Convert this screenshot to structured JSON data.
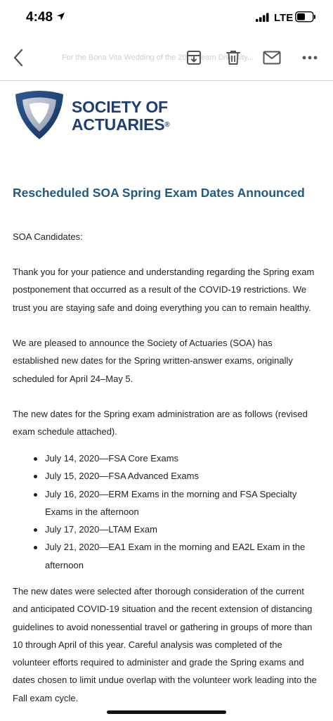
{
  "status_bar": {
    "time": "4:48",
    "network": "LTE"
  },
  "toolbar": {
    "subject_preview": "For the Bona Vita Wedding of the 2020 Team Diversity..."
  },
  "logo": {
    "line1": "SOCIETY OF",
    "line2": "ACTUARIES",
    "reg": "®"
  },
  "email": {
    "headline": "Rescheduled SOA Spring Exam Dates Announced",
    "greeting": "SOA Candidates:",
    "p1": "Thank you for your patience and understanding regarding the Spring exam postponement that occurred as a result of the COVID-19 restrictions. We trust you are staying safe and doing everything you can to remain healthy.",
    "p2": "We are pleased to announce the Society of Actuaries (SOA) has established new dates for the Spring written-answer exams, originally scheduled for April 24–May 5.",
    "p3": "The new dates for the Spring exam administration are as follows (revised exam schedule attached).",
    "dates": [
      "July 14, 2020—FSA Core Exams",
      "July 15, 2020—FSA Advanced Exams",
      "July 16, 2020—ERM Exams in the morning and FSA Specialty Exams in the afternoon",
      "July 17, 2020—LTAM Exam",
      "July 21, 2020—EA1 Exam in the morning and EA2L Exam in the afternoon"
    ],
    "p4": "The new dates were selected after thorough consideration of the current and anticipated COVID-19 situation and the recent extension of distancing guidelines to avoid nonessential travel or gathering in groups of more than 10 through April of this year. Careful analysis was completed of the volunteer efforts required to administer and grade the Spring exams and dates chosen to limit undue overlap with the volunteer work leading into the Fall exam cycle."
  },
  "colors": {
    "brand_navy": "#1f3f73",
    "headline_blue": "#1f5b86"
  }
}
